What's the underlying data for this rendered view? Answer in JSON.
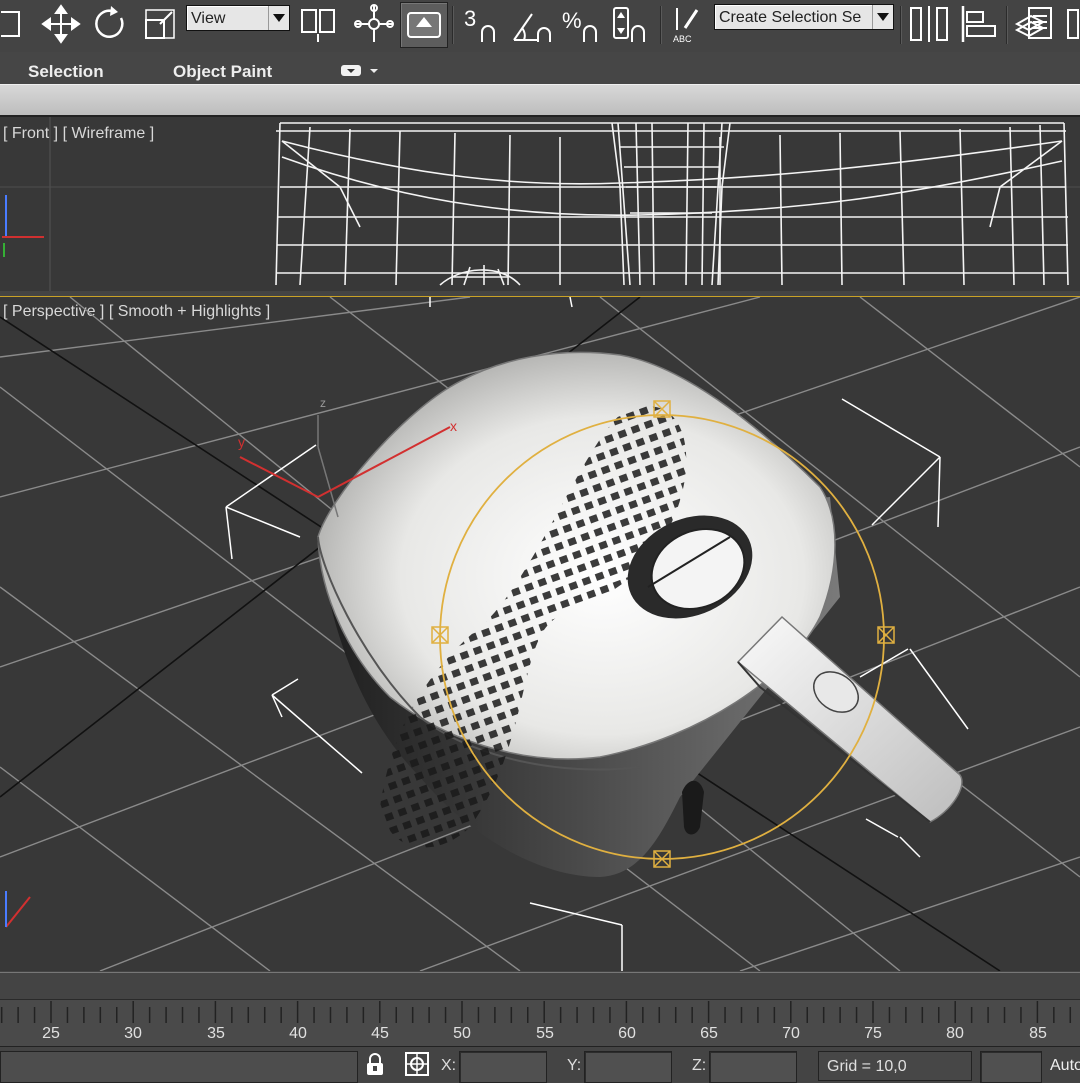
{
  "toolbar": {
    "view_dropdown": "View",
    "selection_set_dropdown": "Create Selection Se"
  },
  "ribbon": {
    "tabs": [
      "Selection",
      "Object Paint"
    ]
  },
  "viewports": {
    "front_label": "[ Front ] [ Wireframe ]",
    "perspective_label": "[ Perspective ] [ Smooth + Highlights ]"
  },
  "timeline": {
    "ticks": [
      "25",
      "30",
      "35",
      "40",
      "45",
      "50",
      "55",
      "60",
      "65",
      "70",
      "75",
      "80",
      "85"
    ]
  },
  "statusbar": {
    "x_label": "X:",
    "y_label": "Y:",
    "z_label": "Z:",
    "grid": "Grid = 10,0",
    "auto": "Auto"
  }
}
